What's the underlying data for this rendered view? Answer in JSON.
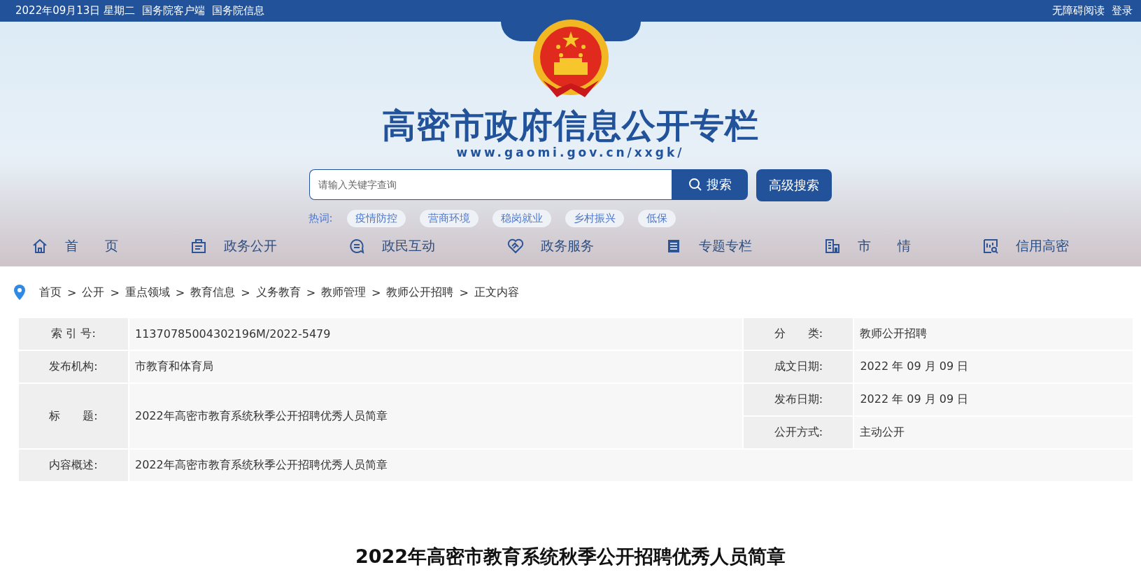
{
  "top_bar": {
    "left": [
      "2022年09月13日 星期二",
      "国务院客户端",
      "国务院信息"
    ],
    "right": [
      "无障碍阅读",
      "登录"
    ]
  },
  "header": {
    "title": "高密市政府信息公开专栏",
    "url": "www.gaomi.gov.cn/xxgk/"
  },
  "search": {
    "placeholder": "请输入关键字查询",
    "button": "搜索",
    "advanced_button": "高级搜索"
  },
  "hot_words": {
    "label": "热词:",
    "items": [
      "疫情防控",
      "营商环境",
      "稳岗就业",
      "乡村振兴",
      "低保"
    ]
  },
  "nav": [
    {
      "label": "首　　页",
      "kind": "home"
    },
    {
      "label": "政务公开",
      "kind": "briefcase"
    },
    {
      "label": "政民互动",
      "kind": "chat"
    },
    {
      "label": "政务服务",
      "kind": "handshake"
    },
    {
      "label": "专题专栏",
      "kind": "document"
    },
    {
      "label": "市　　情",
      "kind": "building"
    },
    {
      "label": "信用高密",
      "kind": "report"
    }
  ],
  "breadcrumb_separator": ">",
  "breadcrumb": [
    "首页",
    "公开",
    "重点领域",
    "教育信息",
    "义务教育",
    "教师管理",
    "教师公开招聘",
    "正文内容"
  ],
  "info_table": {
    "index_label": "索 引 号:",
    "index_value": "11370785004302196M/2022-5479",
    "category_label": "分　　类:",
    "category_value": "教师公开招聘",
    "publisher_label": "发布机构:",
    "publisher_value": "市教育和体育局",
    "created_label": "成文日期:",
    "created_value": "2022 年 09 月 09 日",
    "title_label": "标　　题:",
    "title_value": "2022年高密市教育系统秋季公开招聘优秀人员简章",
    "published_label": "发布日期:",
    "published_value": "2022 年 09 月 09 日",
    "method_label": "公开方式:",
    "method_value": "主动公开",
    "summary_label": "内容概述:",
    "summary_value": "2022年高密市教育系统秋季公开招聘优秀人员简章"
  },
  "article_title": "2022年高密市教育系统秋季公开招聘优秀人员简章"
}
